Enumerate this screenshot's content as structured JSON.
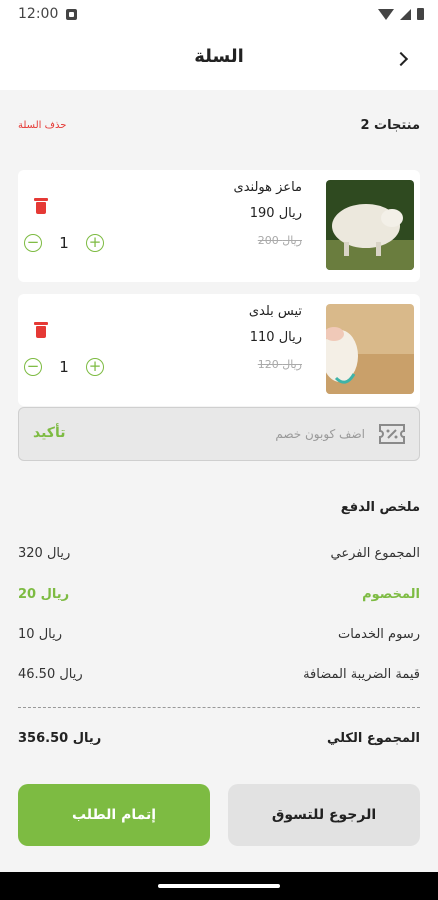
{
  "status_bar": {
    "time": "12:00"
  },
  "header": {
    "title": "السلة"
  },
  "cart_summary": {
    "item_count": "2 منتجات",
    "clear_cart": "حذف السلة"
  },
  "items": [
    {
      "name": "ماعز هولندى",
      "price": "190 ريال",
      "old_price": "200 ريال",
      "quantity": "1"
    },
    {
      "name": "تيس بلدى",
      "price": "110 ريال",
      "old_price": "120 ريال",
      "quantity": "1"
    }
  ],
  "coupon": {
    "placeholder": "اضف كوبون خصم",
    "confirm_label": "تأكيد"
  },
  "payment": {
    "title": "ملخص الدفع",
    "rows": [
      {
        "label": "المجموع الفرعي",
        "value": "320 ريال"
      },
      {
        "label": "المخصوم",
        "value": "20 ريال"
      },
      {
        "label": "رسوم الخدمات",
        "value": "10 ريال"
      },
      {
        "label": "قيمة الضريبة المضافة",
        "value": "46.50 ريال"
      }
    ],
    "total": {
      "label": "المجموع الكلي",
      "value": "356.50 ريال"
    }
  },
  "buttons": {
    "checkout": "إتمام الطلب",
    "back_to_shopping": "الرجوع للتسوق"
  },
  "colors": {
    "accent": "#7dbb42",
    "danger": "#e53935"
  },
  "icons": {
    "back": "chevron-right-icon",
    "delete": "trash-icon",
    "coupon": "coupon-icon"
  }
}
